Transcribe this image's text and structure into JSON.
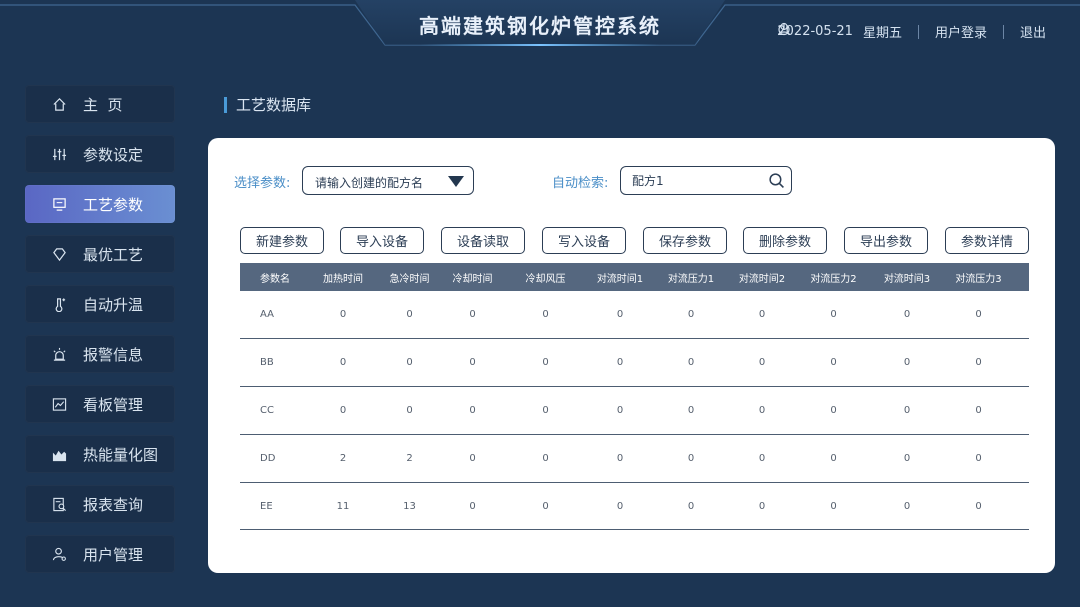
{
  "header": {
    "title": "高端建筑钢化炉管控系统",
    "date": "2022-05-21",
    "weekday": "星期五",
    "login_label": "用户登录",
    "logout_label": "退出",
    "icons": [
      "user-icon",
      "power-icon"
    ]
  },
  "sidebar": {
    "items": [
      {
        "label": "主  页",
        "icon": "home-icon"
      },
      {
        "label": "参数设定",
        "icon": "sliders-icon"
      },
      {
        "label": "工艺参数",
        "icon": "monitor-icon",
        "active": true
      },
      {
        "label": "最优工艺",
        "icon": "diamond-icon"
      },
      {
        "label": "自动升温",
        "icon": "thermometer-icon"
      },
      {
        "label": "报警信息",
        "icon": "alarm-icon"
      },
      {
        "label": "看板管理",
        "icon": "chart-icon"
      },
      {
        "label": "热能量化图",
        "icon": "heatmap-icon"
      },
      {
        "label": "报表查询",
        "icon": "report-icon"
      },
      {
        "label": "用户管理",
        "icon": "user-manage-icon"
      }
    ]
  },
  "main": {
    "section_title": "工艺数据库",
    "filter": {
      "select_label": "选择参数:",
      "select_placeholder": "请输入创建的配方名",
      "search_label": "自动检索:",
      "search_value": "配方1"
    },
    "buttons": [
      "新建参数",
      "导入设备",
      "设备读取",
      "写入设备",
      "保存参数",
      "删除参数",
      "导出参数",
      "参数详情"
    ],
    "table": {
      "columns": [
        "参数名",
        "加热时间",
        "急冷时间",
        "冷却时间",
        "冷却风压",
        "对流时间1",
        "对流压力1",
        "对流时间2",
        "对流压力2",
        "对流时间3",
        "对流压力3"
      ],
      "rows": [
        [
          "AA",
          "0",
          "0",
          "0",
          "0",
          "0",
          "0",
          "0",
          "0",
          "0",
          "0"
        ],
        [
          "BB",
          "0",
          "0",
          "0",
          "0",
          "0",
          "0",
          "0",
          "0",
          "0",
          "0"
        ],
        [
          "CC",
          "0",
          "0",
          "0",
          "0",
          "0",
          "0",
          "0",
          "0",
          "0",
          "0"
        ],
        [
          "DD",
          "2",
          "2",
          "0",
          "0",
          "0",
          "0",
          "0",
          "0",
          "0",
          "0"
        ],
        [
          "EE",
          "11",
          "13",
          "0",
          "0",
          "0",
          "0",
          "0",
          "0",
          "0",
          "0"
        ]
      ]
    }
  },
  "colors": {
    "background": "#1c3553",
    "active_nav": "#6a7fd0",
    "accent": "#4a8ec7",
    "table_header": "#55677f"
  }
}
